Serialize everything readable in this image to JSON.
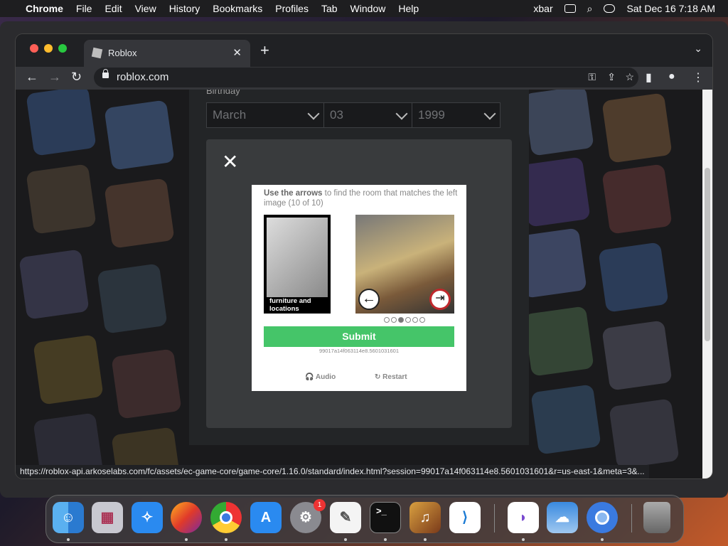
{
  "menubar": {
    "items": [
      "Chrome",
      "File",
      "Edit",
      "View",
      "History",
      "Bookmarks",
      "Profiles",
      "Tab",
      "Window",
      "Help"
    ],
    "xbar": "xbar",
    "datetime": "Sat Dec 16  7:18 AM"
  },
  "browser": {
    "tab_title": "Roblox",
    "url": "roblox.com",
    "status_url": "https://roblox-api.arkoselabs.com/fc/assets/ec-game-core/game-core/1.16.0/standard/index.html?session=99017a14f063114e8.5601031601&r=us-east-1&meta=3&..."
  },
  "signup": {
    "birthday_label": "Birthday",
    "month": "March",
    "day": "03",
    "year": "1999"
  },
  "captcha": {
    "instruction_bold": "Use the arrows",
    "instruction_rest": " to find the room that matches the left image (10 of 10)",
    "left_caption": "furniture and locations",
    "submit_label": "Submit",
    "session_id": "99017a14f063114e8.5601031601",
    "audio_label": "Audio",
    "restart_label": "Restart",
    "carousel_total": 6,
    "carousel_active": 3
  },
  "dock": {
    "apps": [
      "Finder",
      "Launchpad",
      "Safari",
      "Firefox",
      "Chrome",
      "App Store",
      "System Settings",
      "TextEdit",
      "Terminal",
      "GarageBand",
      "Visual Studio Code",
      "Visual Studio",
      "Weather",
      "Chromium",
      "Trash"
    ],
    "system_settings_badge": "1"
  }
}
